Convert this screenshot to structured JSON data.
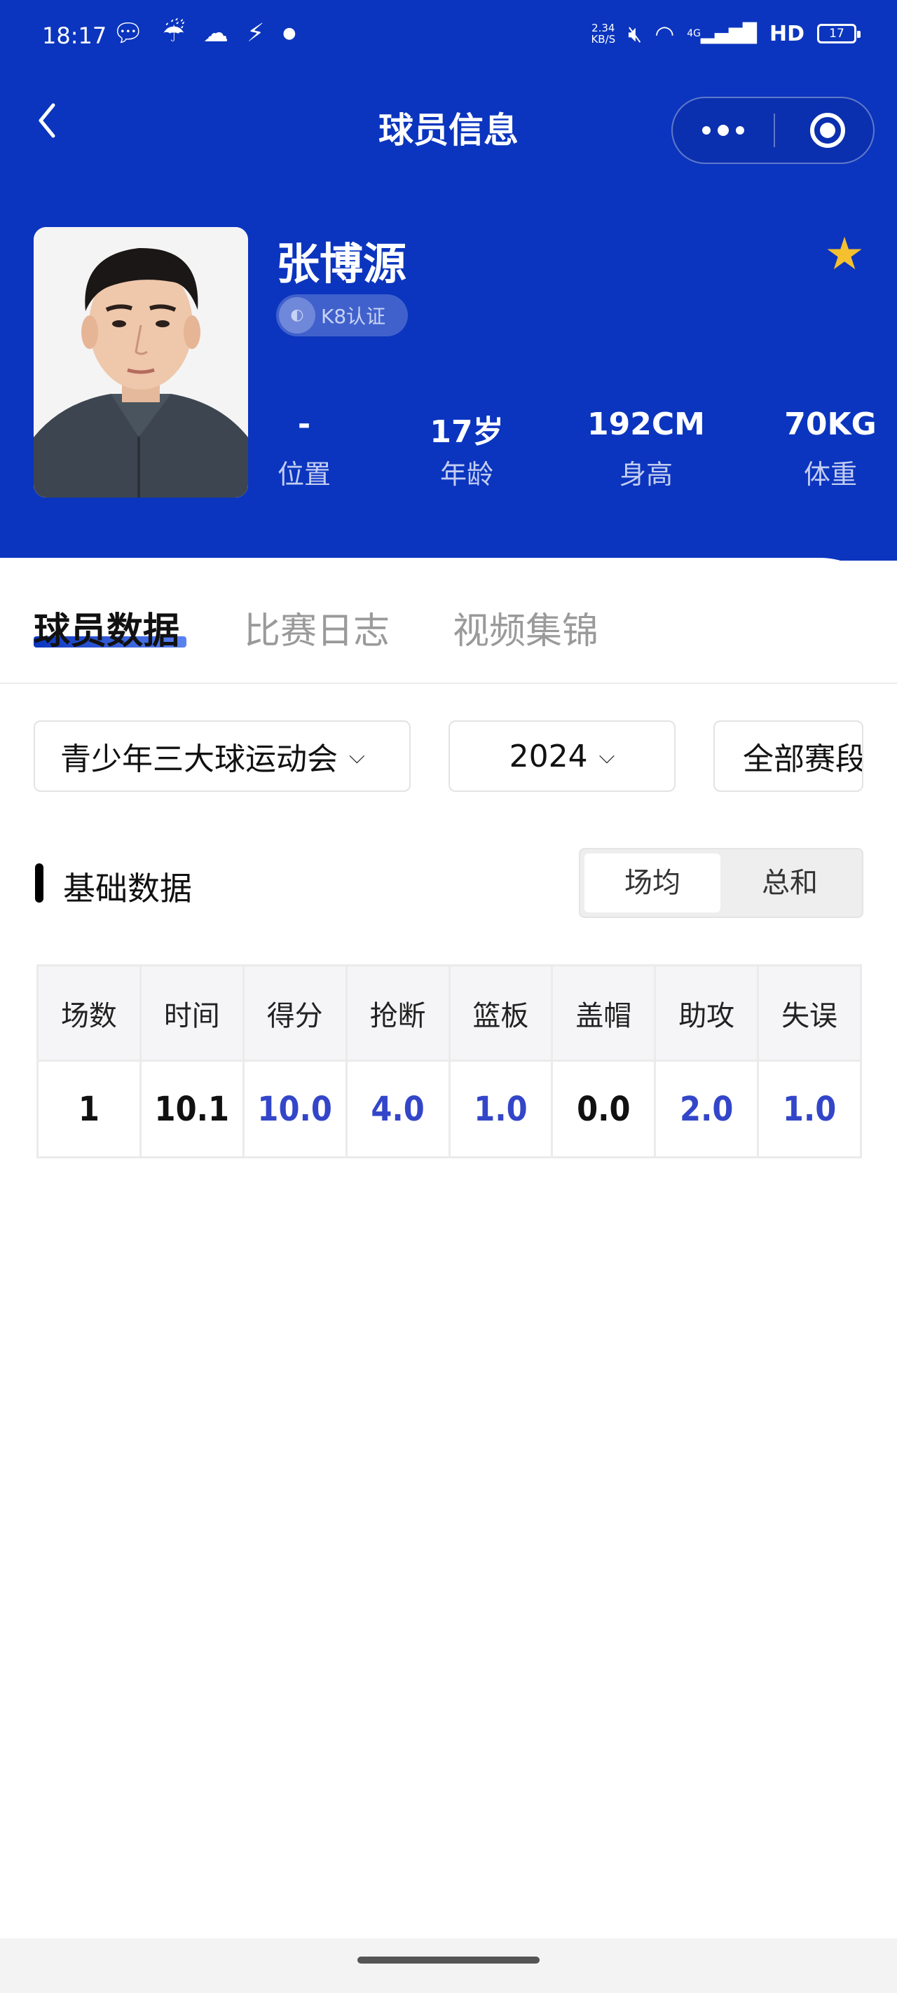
{
  "status_bar": {
    "time": "18:17",
    "netspeed_value": "2.34",
    "netspeed_unit": "KB/S",
    "network_type": "4G",
    "hd_label": "HD",
    "battery_level": "17"
  },
  "nav": {
    "title": "球员信息"
  },
  "player": {
    "name": "张博源",
    "cert_label": "K8认证",
    "stats": [
      {
        "value": "-",
        "label": "位置"
      },
      {
        "value": "17岁",
        "label": "年龄"
      },
      {
        "value": "192CM",
        "label": "身高"
      },
      {
        "value": "70KG",
        "label": "体重"
      }
    ]
  },
  "tabs": [
    "球员数据",
    "比赛日志",
    "视频集锦"
  ],
  "filters": {
    "event": "青少年三大球运动会",
    "year": "2024",
    "stage": "全部赛段"
  },
  "section": {
    "title": "基础数据",
    "toggle": [
      "场均",
      "总和"
    ],
    "active_toggle": "场均"
  },
  "table": {
    "headers": [
      "场数",
      "时间",
      "得分",
      "抢断",
      "篮板",
      "盖帽",
      "助攻",
      "失误"
    ],
    "row": [
      "1",
      "10.1",
      "10.0",
      "4.0",
      "1.0",
      "0.0",
      "2.0",
      "1.0"
    ]
  },
  "colors": {
    "header_blue": "#0b35be",
    "highlight_blue": "#3346c9",
    "star_gold": "#f5c02f"
  }
}
